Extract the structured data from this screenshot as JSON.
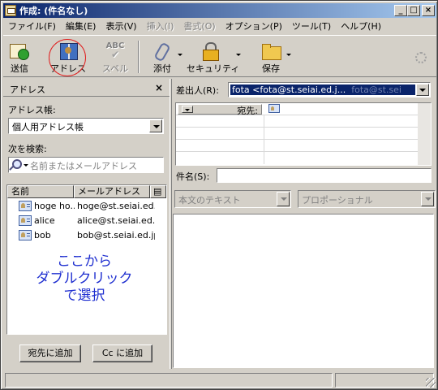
{
  "window": {
    "title": "作成: (件名なし)"
  },
  "menu": [
    "ファイル(F)",
    "編集(E)",
    "表示(V)",
    "挿入(I)",
    "書式(O)",
    "オプション(P)",
    "ツール(T)",
    "ヘルプ(H)"
  ],
  "toolbar": {
    "send": "送信",
    "address": "アドレス",
    "spell": "スペル",
    "spell_icon_text": "ABC",
    "attach": "添付",
    "security": "セキュリティ",
    "save": "保存"
  },
  "left": {
    "title": "アドレス",
    "close": "×",
    "book_label": "アドレス帳:",
    "book_value": "個人用アドレス帳",
    "search_label": "次を検索:",
    "search_placeholder": "名前またはメールアドレス",
    "columns": [
      "名前",
      "メールアドレス"
    ],
    "rows": [
      {
        "name": "hoge ho...",
        "email": "hoge@st.seiai.ed..."
      },
      {
        "name": "alice",
        "email": "alice@st.seiai.ed.j..."
      },
      {
        "name": "bob",
        "email": "bob@st.seiai.ed.jp"
      }
    ],
    "annotation": [
      "ここから",
      "ダブルクリック",
      "で選択"
    ],
    "add_to": "宛先に追加",
    "add_cc": "Cc に追加"
  },
  "compose": {
    "from_label": "差出人(R):",
    "from_value": "fota <fota@st.seiai.ed.j...",
    "from_ghost": "fota@st.sei",
    "to_label": "宛先:",
    "subject_label": "件名(S):",
    "subject_value": "",
    "format_value": "本文のテキスト",
    "font_value": "プロポーショナル"
  },
  "colors": {
    "annotation": "#2030d0",
    "highlight": "#0a246a",
    "circle": "#e02020"
  }
}
